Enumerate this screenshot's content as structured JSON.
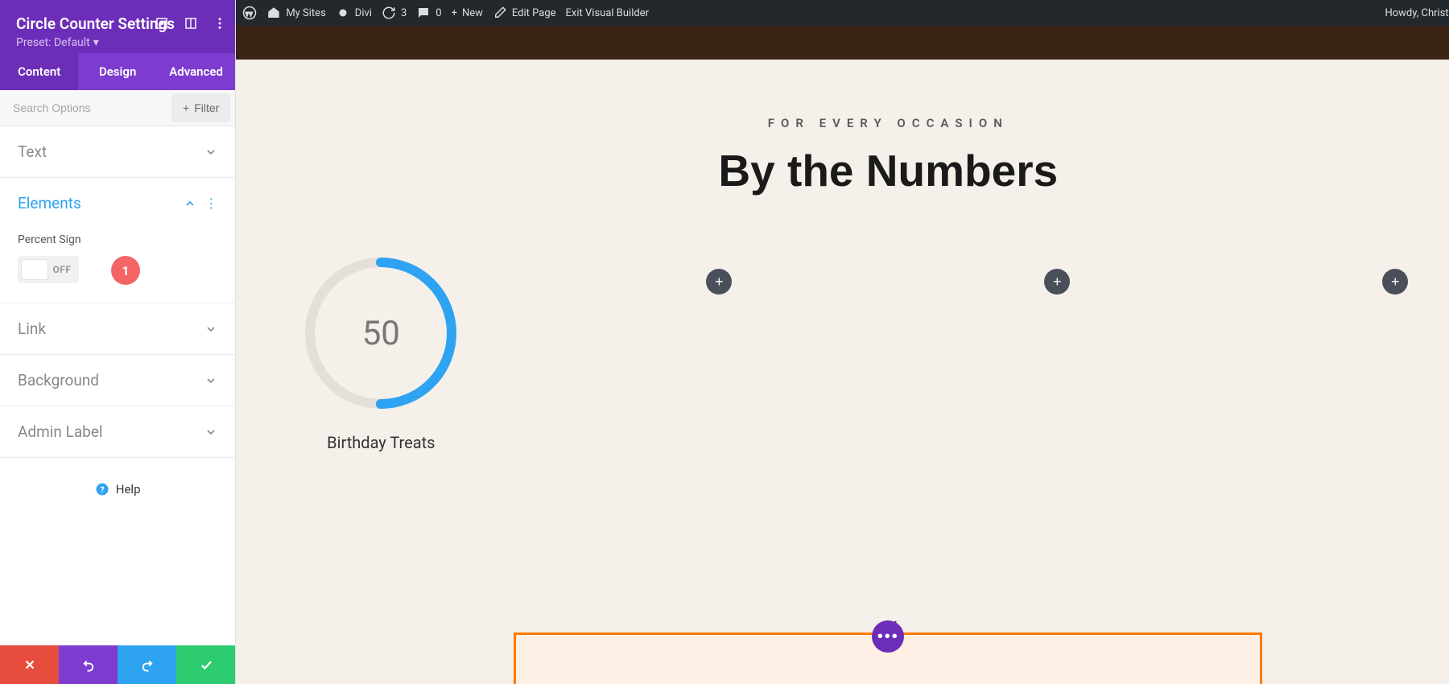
{
  "sidebar": {
    "title": "Circle Counter Settings",
    "preset_label": "Preset: Default",
    "tabs": [
      {
        "label": "Content",
        "active": true
      },
      {
        "label": "Design",
        "active": false
      },
      {
        "label": "Advanced",
        "active": false
      }
    ],
    "search_placeholder": "Search Options",
    "filter_label": "Filter",
    "sections": {
      "text": "Text",
      "elements": "Elements",
      "link": "Link",
      "background": "Background",
      "admin_label": "Admin Label"
    },
    "elements_body": {
      "percent_sign_label": "Percent Sign",
      "toggle_state": "OFF"
    },
    "annotation_badge": "1",
    "help_label": "Help"
  },
  "wpbar": {
    "my_sites": "My Sites",
    "divi": "Divi",
    "updates": "3",
    "comments": "0",
    "new": "New",
    "edit_page": "Edit Page",
    "exit_vb": "Exit Visual Builder",
    "howdy": "Howdy, Christina Gwira"
  },
  "page": {
    "subtitle": "FOR EVERY OCCASION",
    "title": "By the Numbers",
    "counter": {
      "value": "50",
      "label": "Birthday Treats",
      "percent": 50
    },
    "quote_mark": "“"
  },
  "colors": {
    "accent": "#2ea3f2",
    "purple": "#6c2eb9",
    "orange": "#ff7a00"
  }
}
